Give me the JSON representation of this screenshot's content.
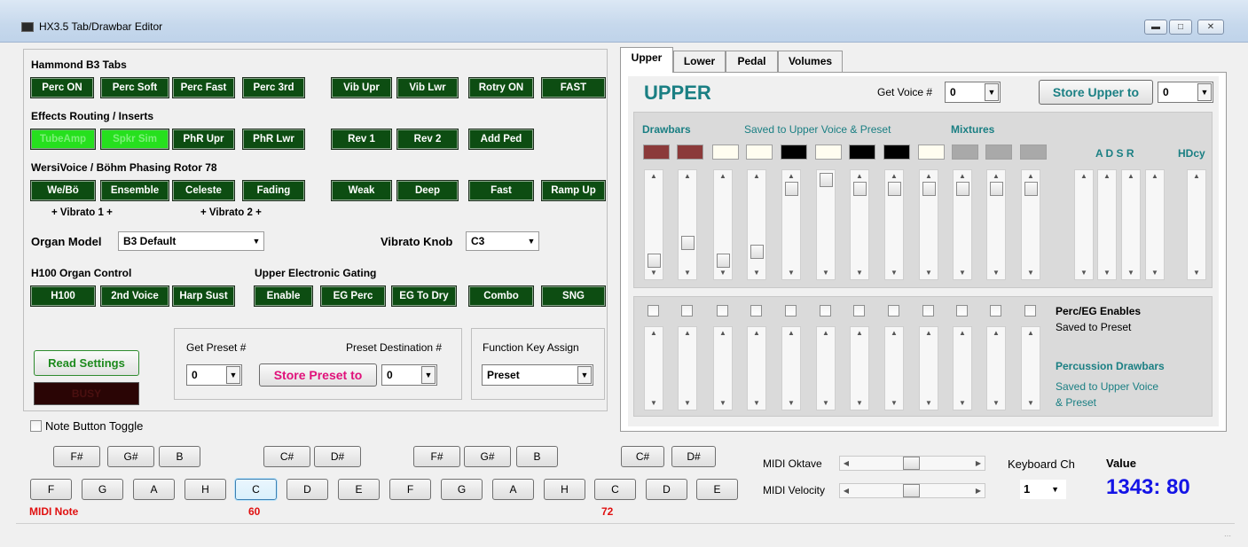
{
  "window": {
    "title": "HX3.5 Tab/Drawbar Editor",
    "min_icon": "minimize-icon",
    "max_icon": "maximize-icon",
    "close_icon": "close-icon"
  },
  "left": {
    "hammond": {
      "title": "Hammond B3 Tabs",
      "buttons": [
        "Perc ON",
        "Perc Soft",
        "Perc Fast",
        "Perc 3rd",
        "Vib Upr",
        "Vib Lwr",
        "Rotry ON",
        "FAST"
      ]
    },
    "effects": {
      "title": "Effects Routing / Inserts",
      "buttons": [
        {
          "label": "TubeAmp",
          "on": true
        },
        {
          "label": "Spkr Sim",
          "on": true
        },
        {
          "label": "PhR Upr",
          "on": false
        },
        {
          "label": "PhR Lwr",
          "on": false
        },
        {
          "label": "Rev 1",
          "on": false
        },
        {
          "label": "Rev 2",
          "on": false
        },
        {
          "label": "Add Ped",
          "on": false
        }
      ]
    },
    "wersi": {
      "title": "WersiVoice / Böhm Phasing Rotor 78",
      "buttons": [
        "We/Bö",
        "Ensemble",
        "Celeste",
        "Fading",
        "Weak",
        "Deep",
        "Fast",
        "Ramp Up"
      ],
      "vibrato1": "+ Vibrato 1 +",
      "vibrato2": "+ Vibrato 2 +"
    },
    "organ_model": {
      "label": "Organ Model",
      "value": "B3 Default"
    },
    "vibrato_knob": {
      "label": "Vibrato Knob",
      "value": "C3"
    },
    "h100": {
      "title": "H100 Organ Control",
      "buttons": [
        "H100",
        "2nd Voice",
        "Harp Sust"
      ]
    },
    "gating": {
      "title": "Upper Electronic Gating",
      "buttons": [
        "Enable",
        "EG Perc",
        "EG To Dry",
        "Combo",
        "SNG"
      ]
    },
    "read_settings": "Read Settings",
    "busy": "BUSY",
    "preset": {
      "get_label": "Get Preset #",
      "get_value": "0",
      "dest_label": "Preset Destination #",
      "store_label": "Store Preset to",
      "dest_value": "0"
    },
    "function_key": {
      "label": "Function Key Assign",
      "value": "Preset"
    },
    "note_toggle": "Note Button Toggle"
  },
  "tabs": [
    {
      "label": "Upper",
      "active": true
    },
    {
      "label": "Lower",
      "active": false
    },
    {
      "label": "Pedal",
      "active": false
    },
    {
      "label": "Volumes",
      "active": false
    }
  ],
  "upper": {
    "heading": "UPPER",
    "get_voice_label": "Get Voice #",
    "get_voice_value": "0",
    "store_label": "Store Upper to",
    "store_value": "0",
    "drawbars_label": "Drawbars",
    "saved_label": "Saved to Upper Voice & Preset",
    "mixtures_label": "Mixtures",
    "adsr_label": "A D S R",
    "hdcy_label": "HDcy",
    "swatch_colors": [
      "#8b3a3a",
      "#8b3a3a",
      "#fffdf0",
      "#fffdf0",
      "#000000",
      "#fffdf0",
      "#000000",
      "#000000",
      "#fffdf0",
      "#a9a9a9",
      "#a9a9a9",
      "#a9a9a9"
    ],
    "drawbar_levels": [
      0,
      2,
      0,
      1,
      8,
      9,
      8,
      8,
      8,
      8,
      8,
      8
    ],
    "perc_label": "Perc/EG Enables",
    "perc_sub": "Saved to Preset",
    "perc_draw_label": "Percussion Drawbars",
    "perc_draw_sub1": "Saved to Upper Voice",
    "perc_draw_sub2": "& Preset"
  },
  "midi": {
    "sharps_top": [
      "F#",
      "G#",
      "B",
      "C#",
      "D#",
      "F#",
      "G#",
      "B",
      "C#",
      "D#"
    ],
    "naturals": [
      "F",
      "G",
      "A",
      "H",
      "C",
      "D",
      "E",
      "F",
      "G",
      "A",
      "H",
      "C",
      "D",
      "E"
    ],
    "note_label": "MIDI Note",
    "mark_60": "60",
    "mark_72": "72",
    "oktave_label": "MIDI Oktave",
    "velocity_label": "MIDI Velocity",
    "keyboard_ch_label": "Keyboard Ch",
    "keyboard_ch_value": "1",
    "value_label": "Value",
    "value": "1343: 80"
  }
}
